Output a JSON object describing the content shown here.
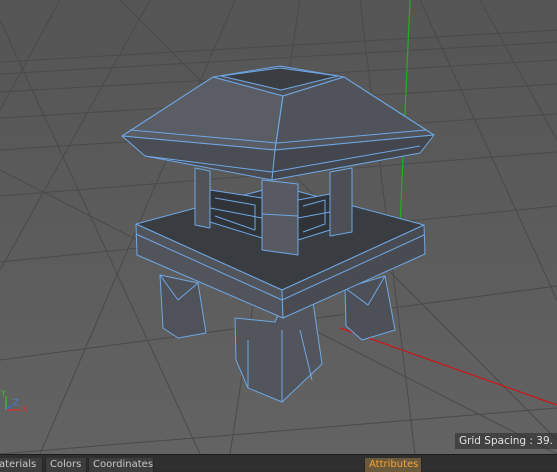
{
  "viewport": {
    "grid_spacing_label": "Grid Spacing : 39.",
    "axis_labels": {
      "x": "X",
      "y": "Y",
      "z": "Z"
    },
    "colors": {
      "background": "#5a5a5a",
      "grid_line": "#4a4a4a",
      "x_axis": "#d01414",
      "y_axis": "#20b020",
      "wireframe": "#6fa6e4",
      "mesh": "#5a5e64"
    }
  },
  "bottom_tabs": {
    "materials": "aterials",
    "colors": "Colors",
    "coordinates": "Coordinates",
    "attributes": "Attributes"
  },
  "accent_color": "#f2a33a"
}
